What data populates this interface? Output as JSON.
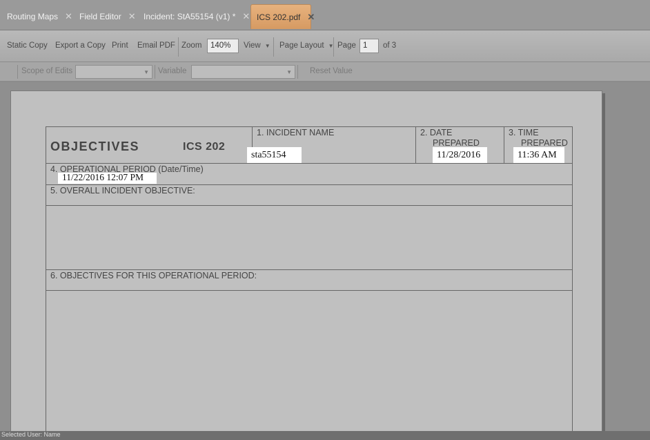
{
  "tabs": [
    {
      "label": "Routing Maps"
    },
    {
      "label": "Field Editor"
    },
    {
      "label": "Incident: StA55154 (v1) *"
    },
    {
      "label": "ICS 202.pdf"
    }
  ],
  "tab_close_glyph": "✕",
  "toolbar": {
    "static_copy": "Static Copy",
    "export_copy": "Export a Copy",
    "print": "Print",
    "email_pdf": "Email PDF",
    "zoom_label": "Zoom",
    "zoom_value": "140%",
    "view": "View",
    "page_layout": "Page Layout",
    "page_label": "Page",
    "page_value": "1",
    "page_of": "of 3",
    "prev_icon": "arrow-left-icon",
    "next_icon": "arrow-right-icon"
  },
  "edit_toolbar": {
    "scope_label": "Scope of Edits",
    "variable_label": "Variable",
    "reset_value": "Reset Value"
  },
  "form": {
    "title": "OBJECTIVES",
    "form_id": "ICS 202",
    "incident_name_label": "1.  INCIDENT NAME",
    "incident_name_value": "sta55154",
    "date_label_1": "2.  DATE",
    "date_label_2": "PREPARED",
    "date_value": "11/28/2016",
    "time_label_1": "3.  TIME",
    "time_label_2": "PREPARED",
    "time_value": "11:36 AM",
    "op_period_label": "4.  OPERATIONAL PERIOD (Date/Time)",
    "op_period_value": "11/22/2016 12:07 PM",
    "overall_objective_label": "5.  OVERALL INCIDENT OBJECTIVE:",
    "objectives_label": "6.  OBJECTIVES FOR THIS OPERATIONAL PERIOD:"
  },
  "status": {
    "text": "Selected    User: Name"
  },
  "colors": {
    "active_tab": "#d69a62",
    "next_arrow": "#2f7fd6",
    "prev_arrow": "#c4c4c4"
  }
}
